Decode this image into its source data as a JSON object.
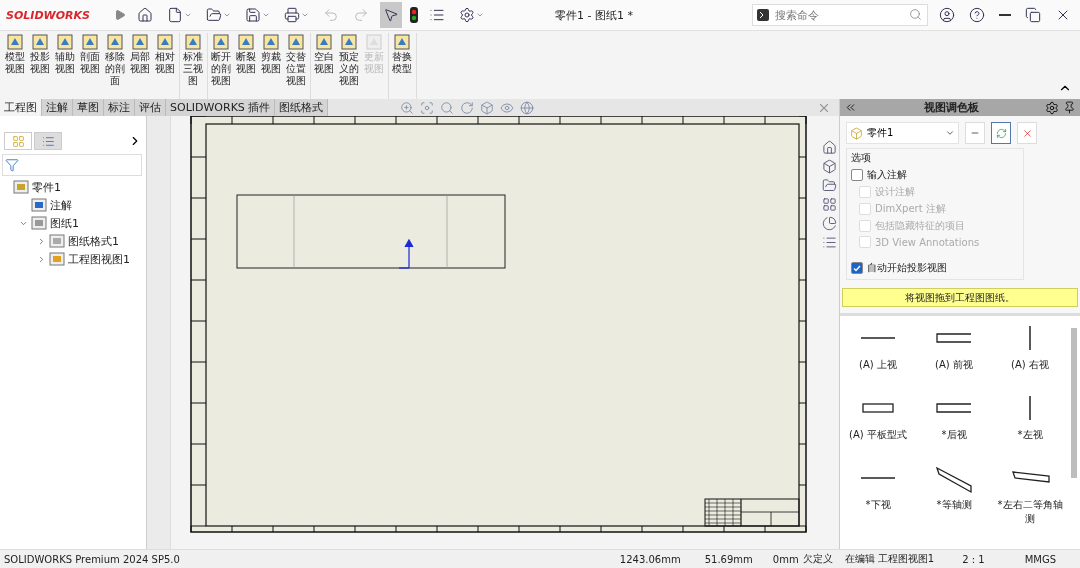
{
  "app": {
    "logo": "SOLIDWORKS",
    "title": "零件1 - 图纸1 *",
    "search": {
      "placeholder": "搜索命令"
    }
  },
  "ribbon": [
    {
      "commands": [
        {
          "label": "模型视图",
          "disabled": false
        },
        {
          "label": "投影视图",
          "disabled": false
        },
        {
          "label": "辅助视图",
          "disabled": false
        },
        {
          "label": "剖面视图",
          "disabled": false
        },
        {
          "label": "移除的剖面",
          "disabled": false
        },
        {
          "label": "局部视图",
          "disabled": false
        },
        {
          "label": "相对视图",
          "disabled": false
        }
      ]
    },
    {
      "commands": [
        {
          "label": "标准三视图",
          "disabled": false
        }
      ]
    },
    {
      "commands": [
        {
          "label": "断开的剖视图",
          "disabled": false
        },
        {
          "label": "断裂视图",
          "disabled": false
        },
        {
          "label": "剪裁视图",
          "disabled": false
        },
        {
          "label": "交替位置视图",
          "disabled": false
        }
      ]
    },
    {
      "commands": [
        {
          "label": "空白视图",
          "disabled": false
        },
        {
          "label": "预定义的视图",
          "disabled": false
        },
        {
          "label": "更新视图",
          "disabled": true
        }
      ]
    },
    {
      "commands": [
        {
          "label": "替换模型",
          "disabled": false
        }
      ]
    }
  ],
  "tabs": [
    {
      "label": "工程图",
      "selected": true
    },
    {
      "label": "注解",
      "selected": false
    },
    {
      "label": "草图",
      "selected": false
    },
    {
      "label": "标注",
      "selected": false
    },
    {
      "label": "评估",
      "selected": false
    },
    {
      "label": "SOLIDWORKS 插件",
      "selected": false
    },
    {
      "label": "图纸格式",
      "selected": false
    }
  ],
  "feature_tree": [
    {
      "label": "零件1",
      "kind": "part",
      "children": [
        {
          "label": "注解",
          "kind": "annotation"
        },
        {
          "label": "图纸1",
          "kind": "sheet",
          "expanded": true,
          "children": [
            {
              "label": "图纸格式1",
              "kind": "format",
              "expanded": false
            },
            {
              "label": "工程图视图1",
              "kind": "view",
              "expanded": false
            }
          ]
        }
      ]
    }
  ],
  "task_pane": {
    "title": "视图调色板",
    "source": "零件1",
    "options_label": "选项",
    "options": [
      {
        "label": "输入注解",
        "checked": false,
        "disabled": false,
        "children": [
          {
            "label": "设计注解",
            "checked": false,
            "disabled": true
          },
          {
            "label": "DimXpert 注解",
            "checked": false,
            "disabled": true
          },
          {
            "label": "包括隐藏特征的项目",
            "checked": false,
            "disabled": true
          },
          {
            "label": "3D View Annotations",
            "checked": false,
            "disabled": true
          }
        ]
      }
    ],
    "auto_project": {
      "label": "自动开始投影视图",
      "checked": true
    },
    "hint": "将视图拖到工程图图纸。",
    "views": [
      {
        "label": "(A) 上视",
        "kind": "hline"
      },
      {
        "label": "(A) 前视",
        "kind": "front"
      },
      {
        "label": "(A) 右视",
        "kind": "vline"
      },
      {
        "label": "(A) 平板型式",
        "kind": "flat"
      },
      {
        "label": "*后视",
        "kind": "back"
      },
      {
        "label": "*左视",
        "kind": "vline"
      },
      {
        "label": "*下视",
        "kind": "hline"
      },
      {
        "label": "*等轴测",
        "kind": "iso"
      },
      {
        "label": "*左右二等角轴测",
        "kind": "dimetric"
      }
    ]
  },
  "status_bar": {
    "product": "SOLIDWORKS Premium 2024 SP5.0",
    "x": "1243.06mm",
    "y": "51.69mm",
    "z": "0mm",
    "state": "欠定义",
    "editing": "在编辑 工程图视图1",
    "scale": "2 : 1",
    "units": "MMGS"
  }
}
